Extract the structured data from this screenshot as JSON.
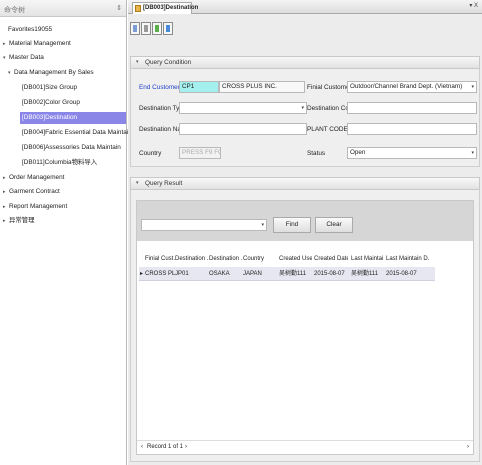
{
  "left_nav": {
    "header": "命令树",
    "items": [
      {
        "label": "Favorites19055",
        "arrow": ""
      },
      {
        "label": "Material Management",
        "arrow": "▸"
      },
      {
        "label": "Master Data",
        "arrow": "▾"
      },
      {
        "label": "Data Management By Sales",
        "arrow": "▾"
      },
      {
        "label": "[DB001]Size Group",
        "arrow": ""
      },
      {
        "label": "[DB002]Color Group",
        "arrow": ""
      },
      {
        "label": "[DB003]Destination",
        "arrow": ""
      },
      {
        "label": "[DB004]Fabric Essential Data Maintain",
        "arrow": ""
      },
      {
        "label": "[DB006]Assessories Data Maintain",
        "arrow": ""
      },
      {
        "label": "[DB011]Columbia物料导入",
        "arrow": ""
      },
      {
        "label": "Order Management",
        "arrow": "▸"
      },
      {
        "label": "Garment Contract",
        "arrow": "▸"
      },
      {
        "label": "Report Management",
        "arrow": "▸"
      },
      {
        "label": "异常管理",
        "arrow": "▸"
      }
    ]
  },
  "tab": {
    "label": "[DB003]Destination",
    "controls": "▾ X"
  },
  "query_condition": {
    "title": "Query Condition",
    "end_customer_label": "End Customer",
    "end_customer_code": "CP1",
    "end_customer_name": "CROSS PLUS INC.",
    "final_customer_label": "Finial Customer",
    "final_customer_value": "Outdoor/Channel Brand Dept. (Vietnam)",
    "destination_type_label": "Destination Type",
    "destination_type_value": "",
    "destination_code_label": "Destination Code",
    "destination_code_value": "",
    "destination_name_label": "Destination Name",
    "destination_name_value": "",
    "plant_code_label": "PLANT CODE:",
    "plant_code_value": "",
    "country_label": "Country",
    "country_value": "PRESS F9 FOR SE",
    "status_label": "Status",
    "status_value": "Open"
  },
  "query_result": {
    "title": "Query Result",
    "search_value": "",
    "find_label": "Find",
    "clear_label": "Clear",
    "columns": [
      "Finial Cust...",
      "Destination ...",
      "Destination ...",
      "Country",
      "Created User",
      "Created Date",
      "Last Maintai...",
      "Last Maintain D..."
    ],
    "rows": [
      [
        "CROSS PL...",
        "JP01",
        "OSAKA",
        "JAPAN",
        "吴树勤111",
        "2015-08-07",
        "吴树勤111",
        "2015-08-07"
      ]
    ],
    "pager": "Record 1 of 1"
  },
  "colors": {
    "selected": "#8a86e8",
    "accent_label": "#1c3fc7",
    "highlight_field": "#a3f0ee"
  },
  "icons": [
    "new-record-icon",
    "edit-icon",
    "save-icon",
    "export-icon"
  ]
}
